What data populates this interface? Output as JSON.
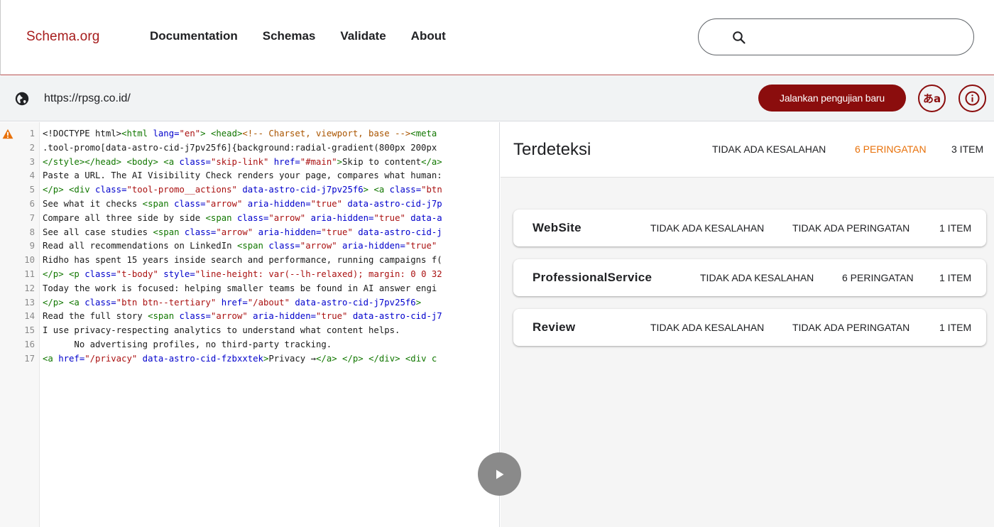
{
  "header": {
    "brand": "Schema.org",
    "nav": [
      "Documentation",
      "Schemas",
      "Validate",
      "About"
    ],
    "search": {
      "value": "",
      "icon": "search-icon"
    }
  },
  "urlbar": {
    "url": "https://rpsg.co.id/",
    "run_button": "Jalankan pengujian baru",
    "lang_button": "あa",
    "icons": [
      "globe-icon",
      "translate-icon",
      "info-icon"
    ]
  },
  "code": {
    "warning_icon": "warning-icon",
    "lines": [
      {
        "n": "1",
        "parts": [
          [
            "p",
            "<!DOCTYPE html>"
          ],
          [
            "g",
            "<html"
          ],
          [
            "a",
            " lang="
          ],
          [
            "s",
            "\"en\""
          ],
          [
            "g",
            ">"
          ],
          [
            "p",
            " "
          ],
          [
            "g",
            "<head>"
          ],
          [
            "c",
            "<!-- Charset, viewport, base -->"
          ],
          [
            "g",
            "<meta"
          ]
        ]
      },
      {
        "n": "2",
        "parts": [
          [
            "p",
            ".tool-promo[data-astro-cid-j7pv25f6]{background:radial-gradient(800px 200px"
          ]
        ]
      },
      {
        "n": "3",
        "parts": [
          [
            "g",
            "</style></head>"
          ],
          [
            "p",
            " "
          ],
          [
            "g",
            "<body>"
          ],
          [
            "p",
            " "
          ],
          [
            "g",
            "<a"
          ],
          [
            "a",
            " class="
          ],
          [
            "s",
            "\"skip-link\""
          ],
          [
            "a",
            " href="
          ],
          [
            "s",
            "\"#main\""
          ],
          [
            "g",
            ">"
          ],
          [
            "p",
            "Skip to content"
          ],
          [
            "g",
            "</a>"
          ]
        ]
      },
      {
        "n": "4",
        "parts": [
          [
            "p",
            "Paste a URL. The AI Visibility Check renders your page, compares what human:"
          ]
        ]
      },
      {
        "n": "5",
        "parts": [
          [
            "g",
            "</p>"
          ],
          [
            "p",
            " "
          ],
          [
            "g",
            "<div"
          ],
          [
            "a",
            " class="
          ],
          [
            "s",
            "\"tool-promo__actions\""
          ],
          [
            "a",
            " data-astro-cid-j7pv25f6"
          ],
          [
            "g",
            ">"
          ],
          [
            "p",
            " "
          ],
          [
            "g",
            "<a"
          ],
          [
            "a",
            " class="
          ],
          [
            "s",
            "\"btn"
          ]
        ]
      },
      {
        "n": "6",
        "parts": [
          [
            "p",
            "See what it checks "
          ],
          [
            "g",
            "<span"
          ],
          [
            "a",
            " class="
          ],
          [
            "s",
            "\"arrow\""
          ],
          [
            "a",
            " aria-hidden="
          ],
          [
            "s",
            "\"true\""
          ],
          [
            "a",
            " data-astro-cid-j7p"
          ]
        ]
      },
      {
        "n": "7",
        "parts": [
          [
            "p",
            "Compare all three side by side "
          ],
          [
            "g",
            "<span"
          ],
          [
            "a",
            " class="
          ],
          [
            "s",
            "\"arrow\""
          ],
          [
            "a",
            " aria-hidden="
          ],
          [
            "s",
            "\"true\""
          ],
          [
            "a",
            " data-a"
          ]
        ]
      },
      {
        "n": "8",
        "parts": [
          [
            "p",
            "See all case studies "
          ],
          [
            "g",
            "<span"
          ],
          [
            "a",
            " class="
          ],
          [
            "s",
            "\"arrow\""
          ],
          [
            "a",
            " aria-hidden="
          ],
          [
            "s",
            "\"true\""
          ],
          [
            "a",
            " data-astro-cid-j"
          ]
        ]
      },
      {
        "n": "9",
        "parts": [
          [
            "p",
            "Read all recommendations on LinkedIn "
          ],
          [
            "g",
            "<span"
          ],
          [
            "a",
            " class="
          ],
          [
            "s",
            "\"arrow\""
          ],
          [
            "a",
            " aria-hidden="
          ],
          [
            "s",
            "\"true\""
          ]
        ]
      },
      {
        "n": "10",
        "parts": [
          [
            "p",
            "Ridho has spent 15 years inside search and performance, running campaigns f("
          ]
        ]
      },
      {
        "n": "11",
        "parts": [
          [
            "g",
            "</p>"
          ],
          [
            "p",
            " "
          ],
          [
            "g",
            "<p"
          ],
          [
            "a",
            " class="
          ],
          [
            "s",
            "\"t-body\""
          ],
          [
            "a",
            " style="
          ],
          [
            "s",
            "\"line-height: var(--lh-relaxed); margin: 0 0 32"
          ]
        ]
      },
      {
        "n": "12",
        "parts": [
          [
            "p",
            "Today the work is focused: helping smaller teams be found in AI answer engi"
          ]
        ]
      },
      {
        "n": "13",
        "parts": [
          [
            "g",
            "</p>"
          ],
          [
            "p",
            " "
          ],
          [
            "g",
            "<a"
          ],
          [
            "a",
            " class="
          ],
          [
            "s",
            "\"btn btn--tertiary\""
          ],
          [
            "a",
            " href="
          ],
          [
            "s",
            "\"/about\""
          ],
          [
            "a",
            " data-astro-cid-j7pv25f6"
          ],
          [
            "g",
            ">"
          ]
        ]
      },
      {
        "n": "14",
        "parts": [
          [
            "p",
            "Read the full story "
          ],
          [
            "g",
            "<span"
          ],
          [
            "a",
            " class="
          ],
          [
            "s",
            "\"arrow\""
          ],
          [
            "a",
            " aria-hidden="
          ],
          [
            "s",
            "\"true\""
          ],
          [
            "a",
            " data-astro-cid-j7"
          ]
        ]
      },
      {
        "n": "15",
        "parts": [
          [
            "p",
            "I use privacy-respecting analytics to understand what content helps."
          ]
        ]
      },
      {
        "n": "16",
        "parts": [
          [
            "p",
            "      No advertising profiles, no third-party tracking."
          ]
        ]
      },
      {
        "n": "17",
        "parts": [
          [
            "g",
            "<a"
          ],
          [
            "a",
            " href="
          ],
          [
            "s",
            "\"/privacy\""
          ],
          [
            "a",
            " data-astro-cid-fzbxxtek"
          ],
          [
            "g",
            ">"
          ],
          [
            "p",
            "Privacy →"
          ],
          [
            "g",
            "</a>"
          ],
          [
            "p",
            " "
          ],
          [
            "g",
            "</p>"
          ],
          [
            "p",
            " "
          ],
          [
            "g",
            "</div>"
          ],
          [
            "p",
            " "
          ],
          [
            "g",
            "<div c"
          ]
        ]
      }
    ]
  },
  "results": {
    "title": "Terdeteksi",
    "summary": {
      "errors": "TIDAK ADA KESALAHAN",
      "warnings": "6 PERINGATAN",
      "items": "3 ITEM"
    },
    "colors": {
      "warning": "#e8710a",
      "accent": "#8b0d0d"
    },
    "types": [
      {
        "name": "WebSite",
        "errors": "TIDAK ADA KESALAHAN",
        "warnings": "TIDAK ADA PERINGATAN",
        "warn_highlight": false,
        "items": "1 ITEM"
      },
      {
        "name": "ProfessionalService",
        "errors": "TIDAK ADA KESALAHAN",
        "warnings": "6 PERINGATAN",
        "warn_highlight": true,
        "items": "1 ITEM"
      },
      {
        "name": "Review",
        "errors": "TIDAK ADA KESALAHAN",
        "warnings": "TIDAK ADA PERINGATAN",
        "warn_highlight": false,
        "items": "1 ITEM"
      }
    ]
  },
  "play_button": {
    "icon": "play-icon"
  }
}
